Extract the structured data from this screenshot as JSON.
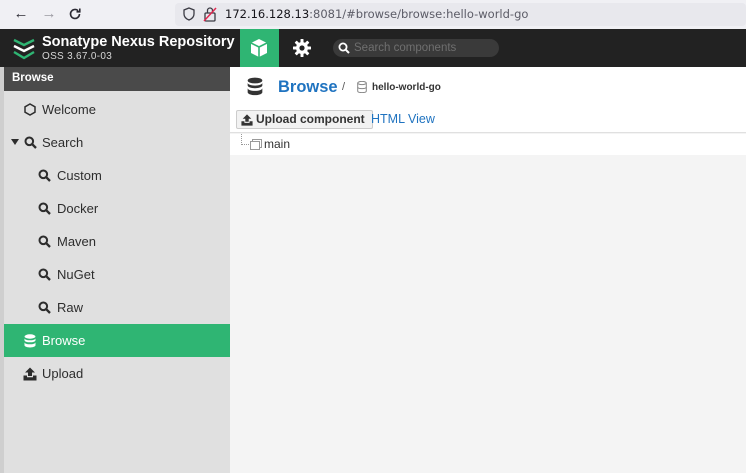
{
  "browser": {
    "url_host": "172.16.128.13",
    "url_rest": ":8081/#browse/browse:hello-world-go"
  },
  "header": {
    "title": "Sonatype Nexus Repository",
    "version": "OSS 3.67.0-03",
    "search_placeholder": "Search components",
    "accent_color": "#2fb573",
    "bg_color": "#222222"
  },
  "sidebar": {
    "header": "Browse",
    "items": [
      {
        "label": "Welcome",
        "icon": "hexagon-icon"
      },
      {
        "label": "Search",
        "icon": "search-icon",
        "expanded": true
      },
      {
        "label": "Custom",
        "icon": "search-icon"
      },
      {
        "label": "Docker",
        "icon": "search-icon"
      },
      {
        "label": "Maven",
        "icon": "search-icon"
      },
      {
        "label": "NuGet",
        "icon": "search-icon"
      },
      {
        "label": "Raw",
        "icon": "search-icon"
      },
      {
        "label": "Browse",
        "icon": "database-icon",
        "active": true
      },
      {
        "label": "Upload",
        "icon": "upload-icon"
      }
    ]
  },
  "main": {
    "breadcrumb_root": "Browse",
    "breadcrumb_sep": "/",
    "repo_name": "hello-world-go",
    "upload_button": "Upload component",
    "html_view_link": "HTML View",
    "tree": [
      {
        "label": "main",
        "icon": "folder-icon"
      }
    ]
  }
}
